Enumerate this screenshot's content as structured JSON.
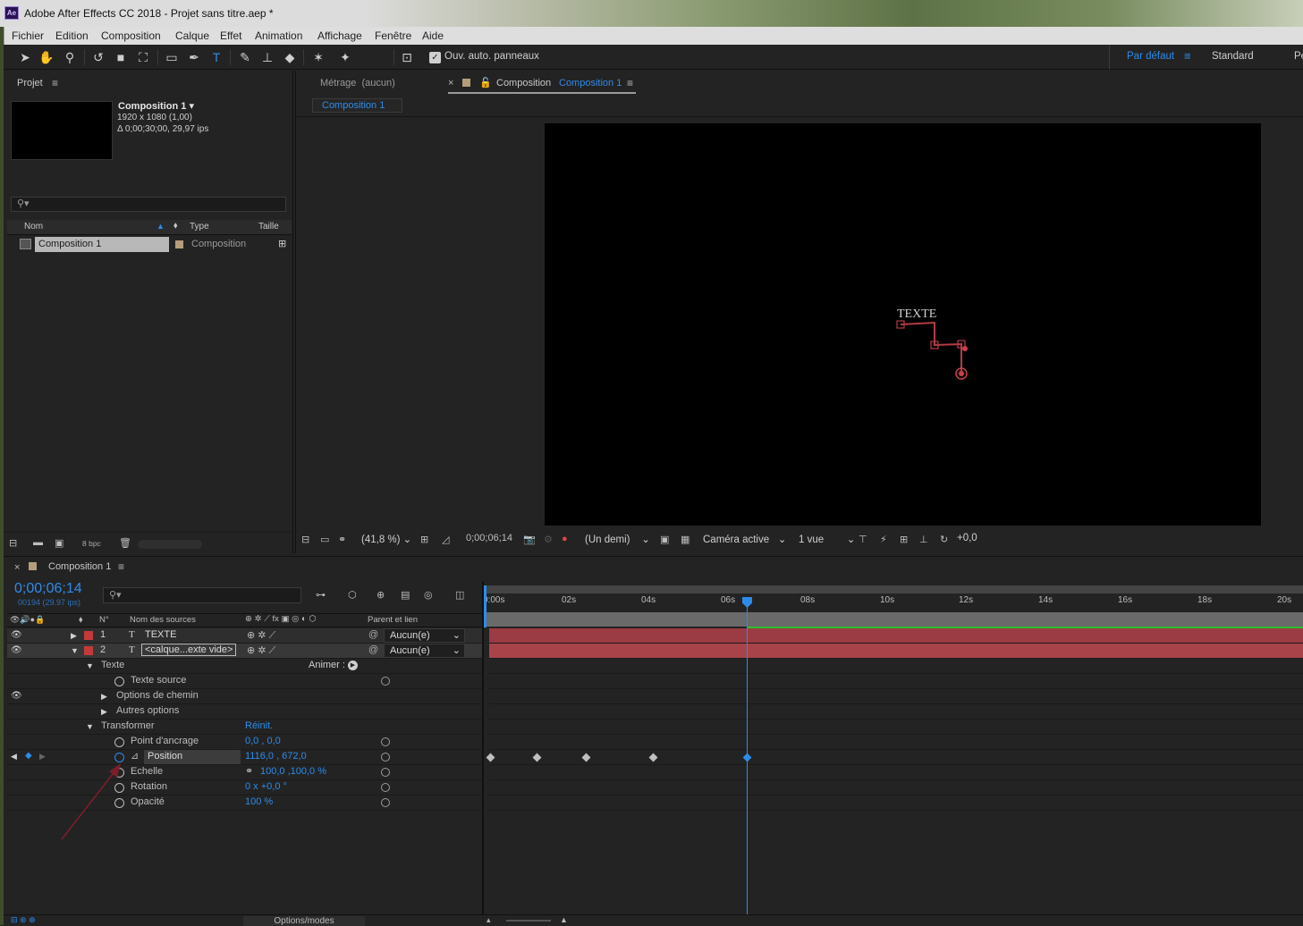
{
  "window": {
    "title": "Adobe After Effects CC 2018 - Projet sans titre.aep *",
    "icon": "Ae"
  },
  "menu": [
    "Fichier",
    "Edition",
    "Composition",
    "Calque",
    "Effet",
    "Animation",
    "Affichage",
    "Fenêtre",
    "Aide"
  ],
  "toolbar": {
    "auto_panels_label": "Ouv. auto. panneaux",
    "workspace_default": "Par défaut",
    "workspace_standard": "Standard",
    "workspace_more": "Pe"
  },
  "project": {
    "panel_title": "Projet",
    "comp_name": "Composition 1 ▾",
    "comp_size": "1920 x 1080 (1,00)",
    "comp_duration": "Δ 0;00;30;00, 29,97 ips",
    "columns": {
      "name": "Nom",
      "type": "Type",
      "size": "Taille"
    },
    "items": [
      {
        "name": "Composition 1",
        "type": "Composition"
      }
    ],
    "bpc": "8 bpc"
  },
  "viewer": {
    "tab_footage": "Métrage",
    "tab_footage_value": "(aucun)",
    "tab_comp_prefix": "Composition",
    "tab_comp_name": "Composition 1",
    "breadcrumb": "Composition 1",
    "canvas_text": "TEXTE",
    "zoom": "(41,8 %)",
    "timecode": "0;00;06;14",
    "resolution": "(Un demi)",
    "camera": "Caméra active",
    "views": "1 vue",
    "exposure": "+0,0"
  },
  "timeline": {
    "tab_title": "Composition 1",
    "timecode": "0;00;06;14",
    "frame_info": "00194 (29.97 ips)",
    "col_num": "N°",
    "col_source": "Nom des sources",
    "col_parent": "Parent et lien",
    "ruler": [
      "0:00s",
      "02s",
      "04s",
      "06s",
      "08s",
      "10s",
      "12s",
      "14s",
      "16s",
      "18s",
      "20s"
    ],
    "layers": [
      {
        "num": "1",
        "type": "T",
        "name": "TEXTE",
        "parent": "Aucun(e)"
      },
      {
        "num": "2",
        "type": "T",
        "name": "<calque...exte vide>",
        "parent": "Aucun(e)"
      }
    ],
    "props": {
      "texte": "Texte",
      "animer": "Animer :",
      "texte_source": "Texte source",
      "options_chemin": "Options de chemin",
      "autres_options": "Autres options",
      "transformer": "Transformer",
      "reinit": "Réinit.",
      "point_ancrage": "Point d'ancrage",
      "point_ancrage_val": "0,0 , 0,0",
      "position": "Position",
      "position_val": "1116,0 , 672,0",
      "echelle": "Echelle",
      "echelle_val": "100,0 ,100,0 %",
      "rotation": "Rotation",
      "rotation_val": "0 x +0,0 °",
      "opacite": "Opacité",
      "opacite_val": "100 %"
    },
    "footer_toggle": "Options/modes"
  },
  "colors": {
    "accent": "#2d8ceb",
    "layer_red": "#c43a3a",
    "bar_red": "#a8434a",
    "arrow": "#7a1f2a"
  }
}
